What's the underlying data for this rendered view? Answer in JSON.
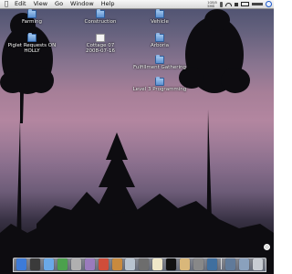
{
  "menubar": {
    "apple_icon": "apple-icon",
    "items": [
      "Edit",
      "View",
      "Go",
      "Window",
      "Help"
    ],
    "extras_meter": [
      "1GB/5",
      "5MB"
    ]
  },
  "desktop_icons": [
    {
      "label": "Farming",
      "sub": "",
      "icon": "folder-icon"
    },
    {
      "label": "Piglet Requests ON",
      "sub": "HOLLY",
      "icon": "folder-icon"
    },
    {
      "label": "Construction",
      "sub": "",
      "icon": "folder-icon"
    },
    {
      "label": "Cottage 07",
      "sub": "2008-07-16",
      "icon": "document-icon"
    },
    {
      "label": "Vehicle",
      "sub": "",
      "icon": "folder-icon"
    },
    {
      "label": "Arboria",
      "sub": "",
      "icon": "folder-icon"
    },
    {
      "label": "Fulfillment Gathering",
      "sub": "",
      "icon": "folder-icon"
    },
    {
      "label": "Level 3 Programming",
      "sub": "",
      "icon": "folder-icon"
    }
  ],
  "dock": {
    "items": [
      {
        "name": "finder-icon",
        "color": "#3d7bd8"
      },
      {
        "name": "dashboard-icon",
        "color": "#3a3a3a"
      },
      {
        "name": "safari-icon",
        "color": "#6aa9e8"
      },
      {
        "name": "itunes-icon",
        "color": "#4ca14d"
      },
      {
        "name": "ichat-icon",
        "color": "#b0b0b0"
      },
      {
        "name": "mail-icon",
        "color": "#9a7bbd"
      },
      {
        "name": "ical-icon",
        "color": "#d04d3a"
      },
      {
        "name": "iphoto-icon",
        "color": "#c98a3e"
      },
      {
        "name": "preview-icon",
        "color": "#b9c4d0"
      },
      {
        "name": "photo-booth-icon",
        "color": "#6d6d6d"
      },
      {
        "name": "textedit-icon",
        "color": "#efe7c8"
      },
      {
        "name": "terminal-icon",
        "color": "#111111"
      },
      {
        "name": "address-book-icon",
        "color": "#d9b77a"
      },
      {
        "name": "system-preferences-icon",
        "color": "#888888"
      },
      {
        "name": "time-machine-icon",
        "color": "#3f6f9f"
      },
      {
        "name": "downloads-stack-icon",
        "color": "#607a9a"
      },
      {
        "name": "documents-stack-icon",
        "color": "#8aa1bd"
      },
      {
        "name": "trash-icon",
        "color": "#c8ccd2"
      }
    ]
  }
}
